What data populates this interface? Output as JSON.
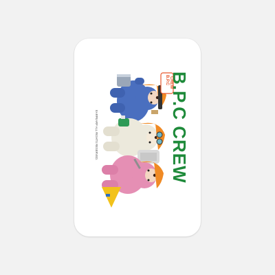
{
  "product": {
    "brand_title": "B.P.C CREW",
    "badge_line1": "B.P.C",
    "badge_line2": "CREW",
    "copyright": "EARPEARP ALL RIGHTS RESERVED.",
    "colors": {
      "title_green": "#1e8a3a",
      "badge_orange": "#e8562a",
      "background": "#f2f2f2",
      "card": "#ffffff",
      "blue_bear": "#4a6fbf",
      "cream_bear": "#ece9dc",
      "pink_bear": "#e58fb4",
      "helmet_orange": "#f08a24"
    }
  }
}
